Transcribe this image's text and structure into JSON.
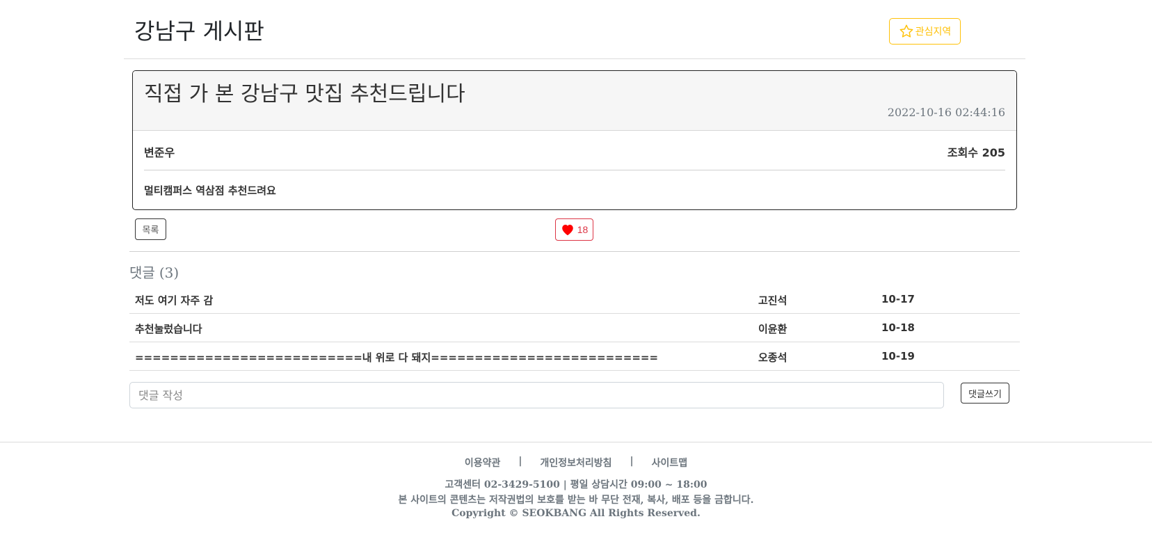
{
  "header": {
    "title": "강남구 게시판",
    "favorite_label": "관심지역"
  },
  "post": {
    "title": "직접 가 본 강남구 맛집 추천드립니다",
    "date": "2022-10-16 02:44:16",
    "author": "변준우",
    "views": "조회수 205",
    "content": "멀티캠퍼스 역삼점 추천드려요"
  },
  "actions": {
    "list_label": "목록",
    "like_count": "18"
  },
  "comments": {
    "title": "댓글",
    "count": "(3)",
    "items": [
      {
        "text": "저도 여기 자주 감",
        "author": "고진석",
        "date": "10-17"
      },
      {
        "text": "추천눌렀습니다",
        "author": "이윤환",
        "date": "10-18"
      },
      {
        "text": "==========================내 위로 다 돼지==========================",
        "author": "오종석",
        "date": "10-19"
      }
    ],
    "input_placeholder": "댓글 작성",
    "submit_label": "댓글쓰기"
  },
  "footer": {
    "links": [
      "이용약관",
      "|",
      "개인정보처리방침",
      "|",
      "사이트맵"
    ],
    "contact": "고객센터 02-3429-5100 | 평일 상담시간 09:00 ~ 18:00",
    "notice": "본 사이트의 콘텐츠는 저작권법의 보호를 받는 바 무단 전재, 복사, 배포 등을 금합니다.",
    "copyright": "Copyright © SEOKBANG All Rights Reserved."
  },
  "colors": {
    "favorite": "#ffc107",
    "like": "#dc3545",
    "heart_fill": "#ff0000",
    "muted": "#6c757d"
  }
}
